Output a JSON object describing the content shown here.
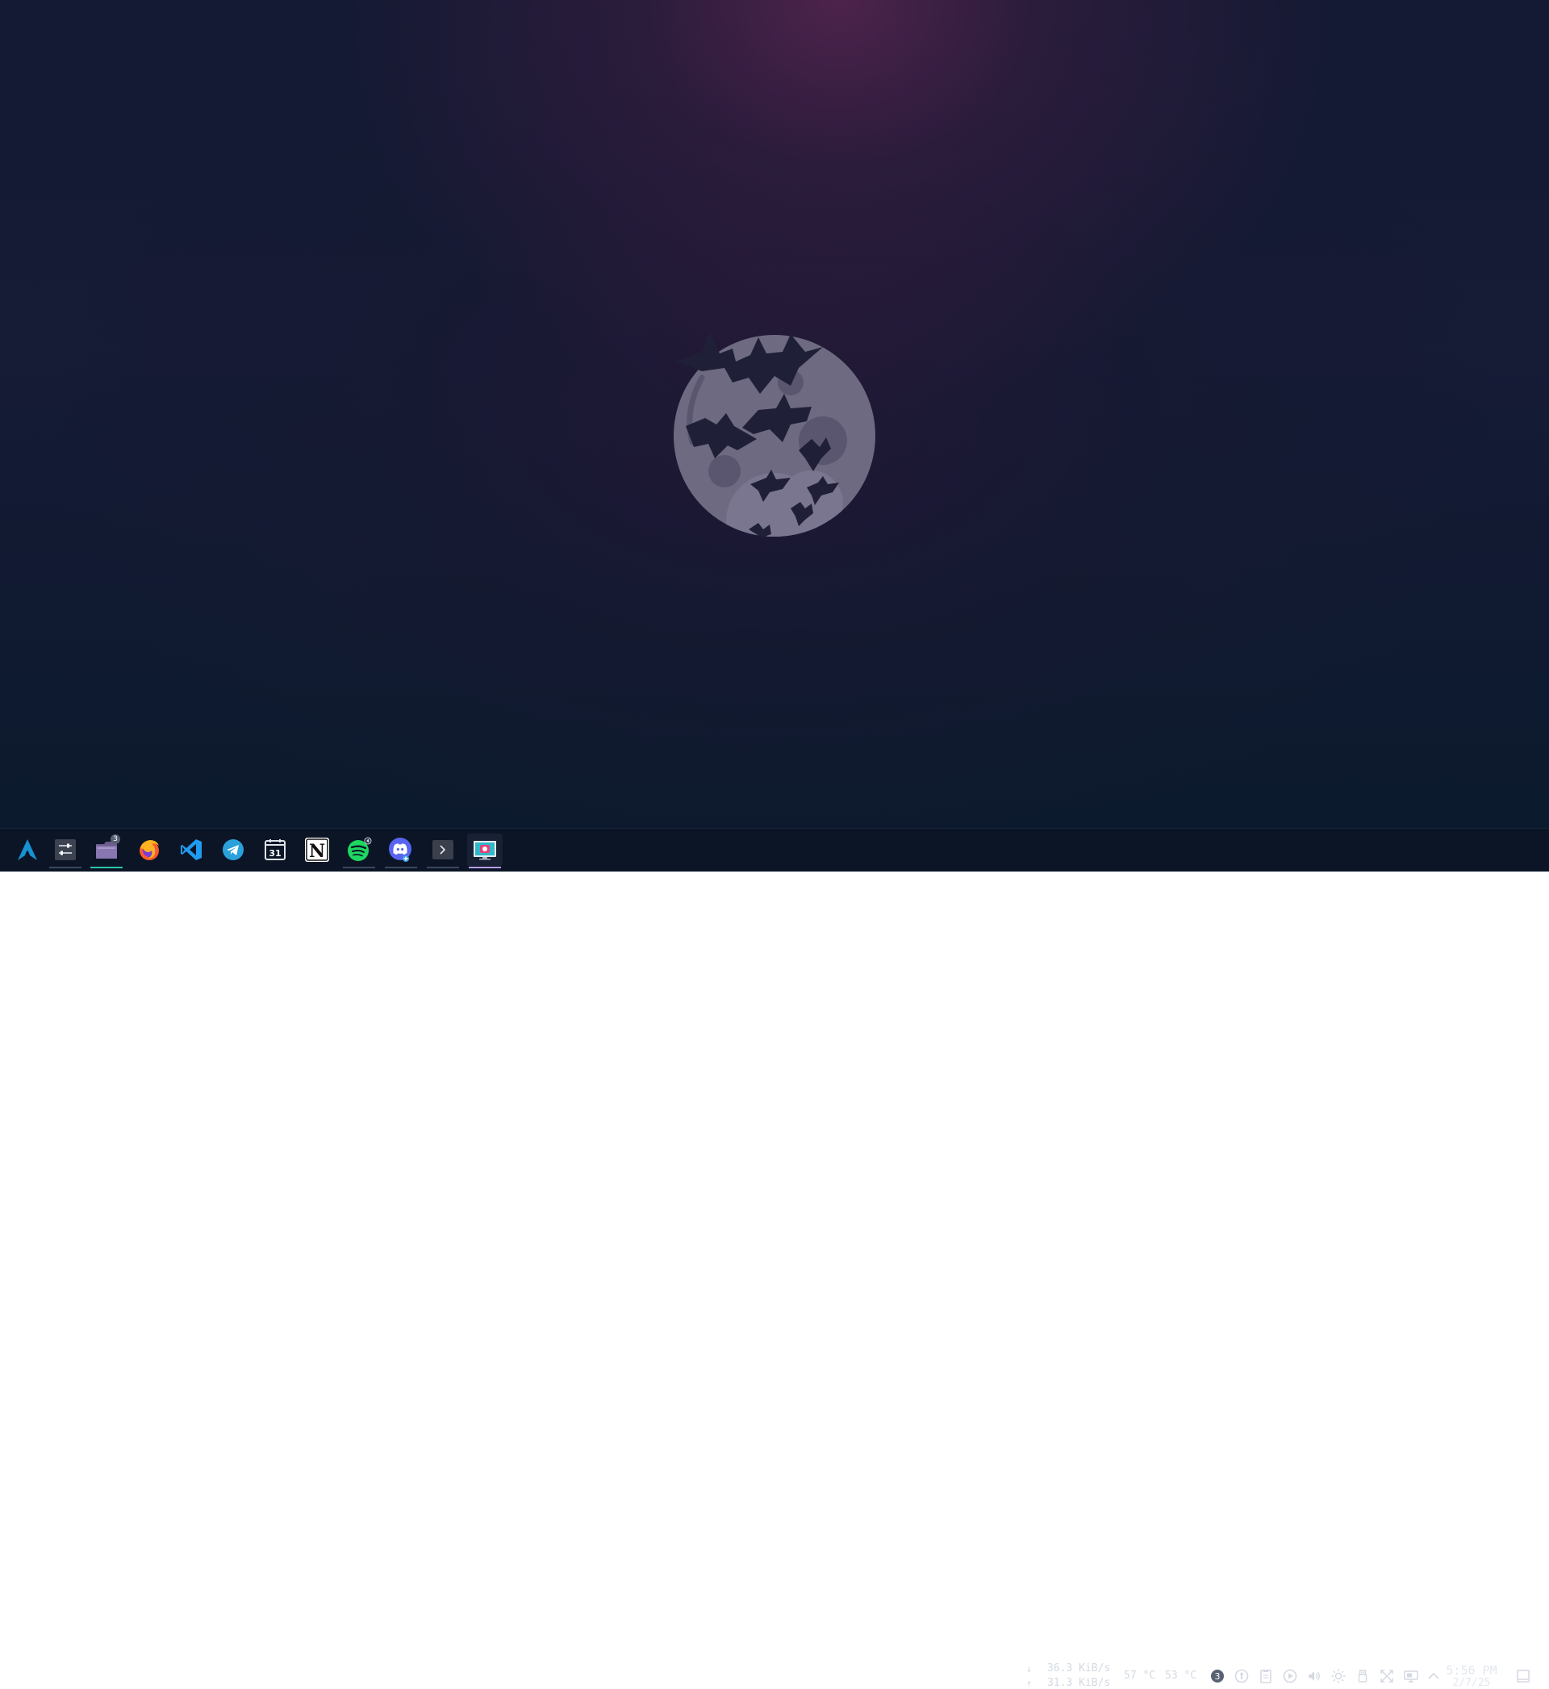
{
  "desktop": {
    "wallpaper_colors": {
      "top_glow": "#5c2650",
      "mid": "#1a1b38",
      "bottom": "#0b1a2c",
      "moon": "#6e6a82",
      "bats": "#1f2038"
    }
  },
  "taskbar": {
    "launcher": {
      "icon": "arch-linux-icon"
    },
    "apps": [
      {
        "name": "system-settings",
        "icon": "settings-sliders-icon",
        "running": false
      },
      {
        "name": "file-manager",
        "icon": "folder-icon",
        "badge": "3",
        "running": true
      },
      {
        "name": "firefox",
        "icon": "firefox-icon",
        "running": false
      },
      {
        "name": "vscode",
        "icon": "vscode-icon",
        "running": false
      },
      {
        "name": "telegram",
        "icon": "telegram-icon",
        "running": false
      },
      {
        "name": "calendar",
        "icon": "calendar-icon",
        "label": "31",
        "running": false
      },
      {
        "name": "notion",
        "icon": "notion-icon",
        "label": "N",
        "running": false
      },
      {
        "name": "spotify",
        "icon": "spotify-icon",
        "running": true
      },
      {
        "name": "discord",
        "icon": "discord-icon",
        "running": true
      },
      {
        "name": "terminal",
        "icon": "terminal-icon",
        "running": true
      },
      {
        "name": "screenshot-tool",
        "icon": "screenshot-icon",
        "running": true,
        "focused": true
      }
    ],
    "tray": {
      "net_down": "36.3 KiB/s",
      "net_up": "31.3 KiB/s",
      "temp_cpu": "57 °C",
      "temp_gpu": "53 °C",
      "notification_count": "3",
      "icons": [
        "notifications-icon",
        "vpn-icon",
        "clipboard-icon",
        "media-play-icon",
        "volume-icon",
        "brightness-icon",
        "usb-icon",
        "kde-connect-icon",
        "display-icon",
        "expand-tray-icon"
      ]
    },
    "clock": {
      "time": "5:56 PM",
      "date": "2/7/25"
    }
  }
}
